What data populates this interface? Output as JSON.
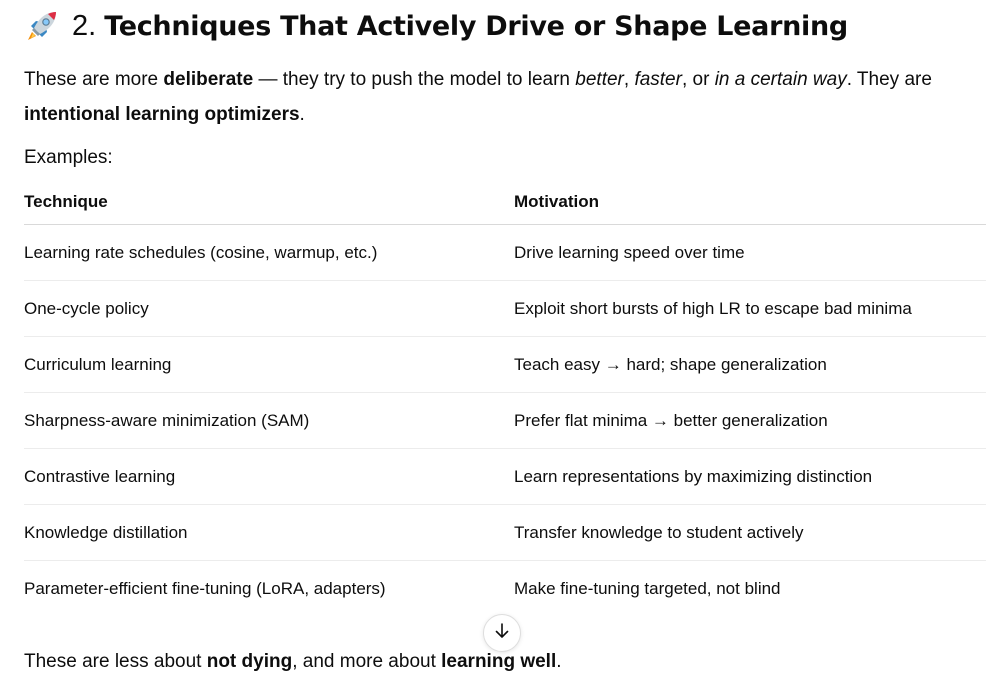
{
  "heading": {
    "icon": "rocket-emoji",
    "number": "2.",
    "title": "Techniques That Actively Drive or Shape Learning"
  },
  "intro": {
    "t1": "These are more ",
    "b1": "deliberate",
    "t2": " — they try to push the model to learn ",
    "i1": "better",
    "t3": ", ",
    "i2": "faster",
    "t4": ", or ",
    "i3": "in a certain way",
    "t5": ". They are ",
    "b2": "intentional learning optimizers",
    "t6": "."
  },
  "examples_label": "Examples:",
  "table": {
    "headers": [
      "Technique",
      "Motivation"
    ],
    "rows": [
      [
        "Learning rate schedules (cosine, warmup, etc.)",
        "Drive learning speed over time"
      ],
      [
        "One-cycle policy",
        "Exploit short bursts of high LR to escape bad minima"
      ],
      [
        "Curriculum learning",
        "Teach easy → hard; shape generalization"
      ],
      [
        "Sharpness-aware minimization (SAM)",
        "Prefer flat minima → better generalization"
      ],
      [
        "Contrastive learning",
        "Learn representations by maximizing distinction"
      ],
      [
        "Knowledge distillation",
        "Transfer knowledge to student actively"
      ],
      [
        "Parameter-efficient fine-tuning (LoRA, adapters)",
        "Make fine-tuning targeted, not blind"
      ]
    ]
  },
  "scroll_button": {
    "icon": "arrow-down-icon"
  },
  "footer": {
    "t1": "These are less about ",
    "b1": "not dying",
    "t2": ", and more about ",
    "b2": "learning well",
    "t3": "."
  }
}
